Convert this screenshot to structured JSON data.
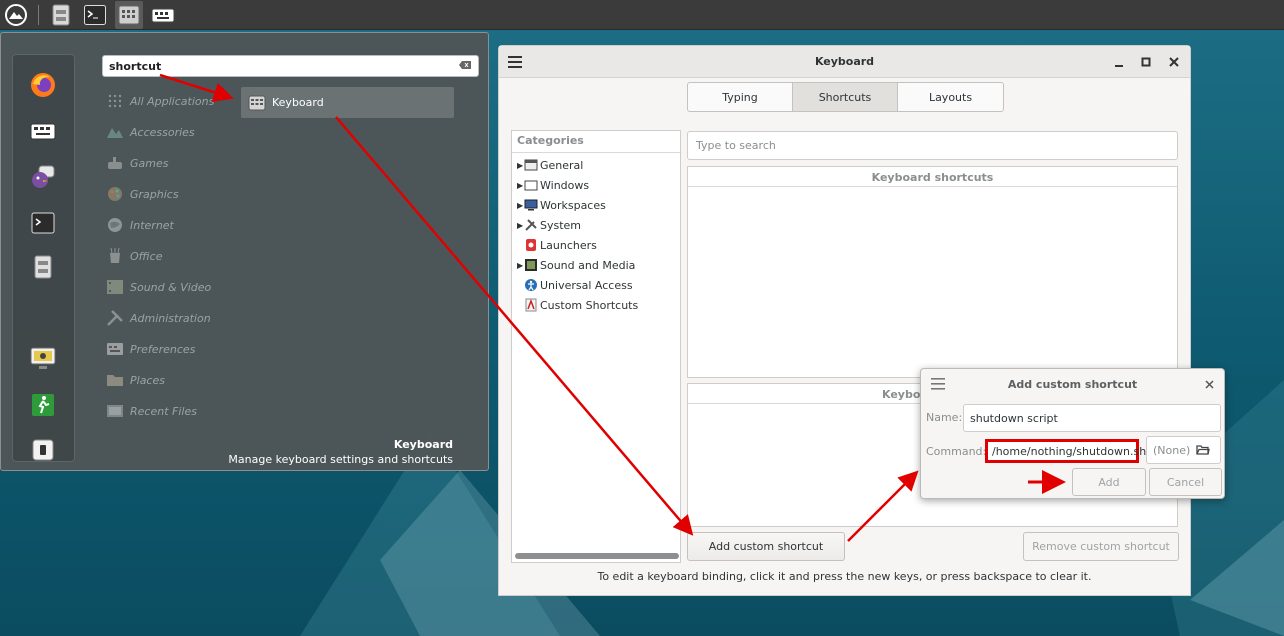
{
  "colors": {
    "accent_red": "#e00000",
    "desktop": "#1d6f86",
    "panel": "#3b3b3b",
    "menu": "#4e5658"
  },
  "panel": {
    "items": [
      "menu-icon",
      "file-manager-icon",
      "terminal-icon",
      "keyboard-icon",
      "keyboard-alt-icon"
    ]
  },
  "menu": {
    "search_value": "shortcut",
    "categories": [
      "All Applications",
      "Accessories",
      "Games",
      "Graphics",
      "Internet",
      "Office",
      "Sound & Video",
      "Administration",
      "Preferences",
      "Places",
      "Recent Files"
    ],
    "result_label": "Keyboard",
    "description_title": "Keyboard",
    "description": "Manage keyboard settings and shortcuts"
  },
  "window": {
    "title": "Keyboard",
    "tabs": [
      "Typing",
      "Shortcuts",
      "Layouts"
    ],
    "categories_header": "Categories",
    "categories": [
      "General",
      "Windows",
      "Workspaces",
      "System",
      "Launchers",
      "Sound and Media",
      "Universal Access",
      "Custom Shortcuts"
    ],
    "search_placeholder": "Type to search",
    "shortcuts_header": "Keyboard shortcuts",
    "bindings_header": "Keyboa",
    "add_button": "Add custom shortcut",
    "remove_button": "Remove custom shortcut",
    "hint": "To edit a keyboard binding, click it and press the new keys, or press backspace to clear it."
  },
  "dialog": {
    "title": "Add custom shortcut",
    "name_label": "Name:",
    "name_value": "shutdown script",
    "command_label": "Command:",
    "command_value": "/home/nothing/shutdown.sh",
    "browse_label": "(None)",
    "add_button": "Add",
    "cancel_button": "Cancel"
  }
}
